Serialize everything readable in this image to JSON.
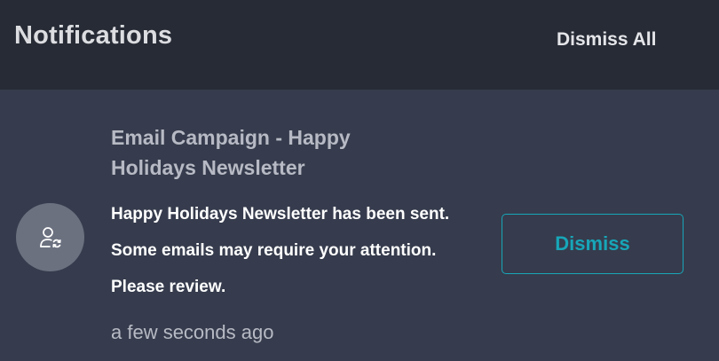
{
  "header": {
    "title": "Notifications",
    "dismiss_all_label": "Dismiss All"
  },
  "notification": {
    "icon": "user-sync-icon",
    "title": "Email Campaign - Happy Holidays Newsletter",
    "message": "Happy Holidays Newsletter has been sent. Some emails may require your attention. Please review.",
    "time": "a few seconds ago",
    "dismiss_label": "Dismiss"
  },
  "colors": {
    "header_bg": "#272b35",
    "panel_bg": "#363c4d",
    "accent": "#17a6b8",
    "avatar_bg": "#6c7180"
  }
}
